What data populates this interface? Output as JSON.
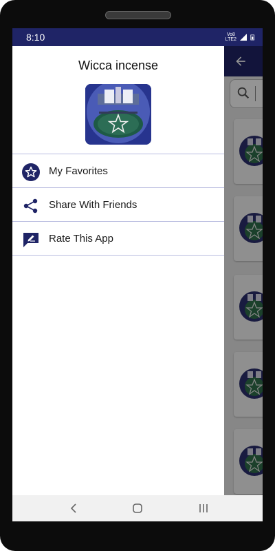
{
  "status_bar": {
    "time": "8:10",
    "network_top": "Vo8",
    "network_bottom": "LTE2"
  },
  "drawer": {
    "title": "Wicca incense",
    "logo_icon": "pentagram-altar-logo",
    "items": [
      {
        "label": "My Favorites",
        "icon": "star-icon"
      },
      {
        "label": "Share With Friends",
        "icon": "share-icon"
      },
      {
        "label": "Rate This App",
        "icon": "rate-icon"
      }
    ]
  },
  "colors": {
    "primary": "#1f2466",
    "drawer_divider": "#b9bce0",
    "nav_bar": "#f1f1f1"
  }
}
